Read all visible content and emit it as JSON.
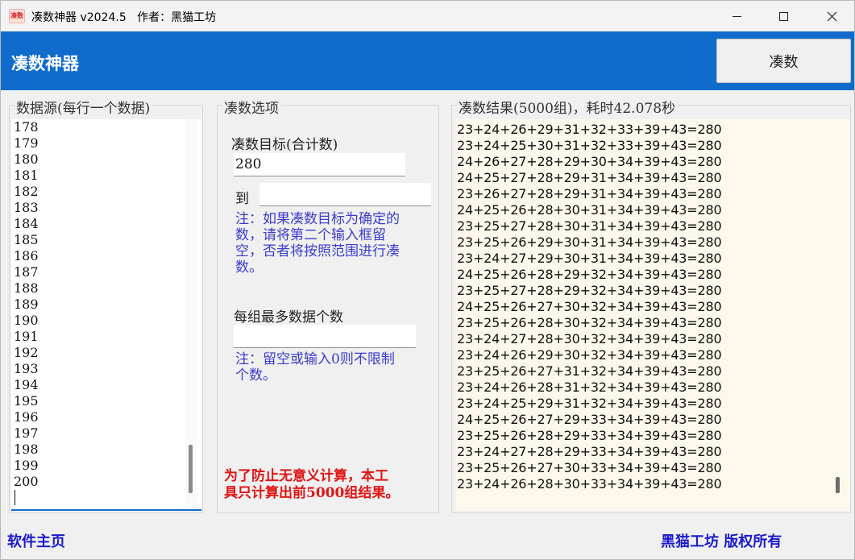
{
  "window": {
    "icon_text": "凑数",
    "title": "凑数神器 v2024.5   作者：黑猫工坊"
  },
  "header": {
    "title": "凑数神器",
    "run_button": "凑数"
  },
  "source": {
    "group_title": "数据源(每行一个数据)",
    "lines": [
      "178",
      "179",
      "180",
      "181",
      "182",
      "183",
      "184",
      "185",
      "186",
      "187",
      "188",
      "189",
      "190",
      "191",
      "192",
      "193",
      "194",
      "195",
      "196",
      "197",
      "198",
      "199",
      "200"
    ]
  },
  "options": {
    "group_title": "凑数选项",
    "target_label": "凑数目标(合计数)",
    "target_value": "280",
    "to_label": "到",
    "to_value": "",
    "note1_lines": [
      "注：如果凑数目标为确定的",
      "数，请将第二个输入框留",
      "空，否者将按照范围进行凑",
      "数。"
    ],
    "max_label": "每组最多数据个数",
    "max_value": "",
    "note2_lines": [
      "注：留空或输入0则不限制",
      "个数。"
    ],
    "warn_lines": [
      "为了防止无意义计算，本工",
      "具只计算出前5000组结果。"
    ]
  },
  "result": {
    "group_title": "凑数结果(5000组)，耗时42.078秒",
    "lines": [
      "23+24+26+29+31+32+33+39+43=280",
      "23+24+25+30+31+32+33+39+43=280",
      "24+26+27+28+29+30+34+39+43=280",
      "24+25+27+28+29+31+34+39+43=280",
      "23+26+27+28+29+31+34+39+43=280",
      "24+25+26+28+30+31+34+39+43=280",
      "23+25+27+28+30+31+34+39+43=280",
      "23+25+26+29+30+31+34+39+43=280",
      "23+24+27+29+30+31+34+39+43=280",
      "24+25+26+28+29+32+34+39+43=280",
      "23+25+27+28+29+32+34+39+43=280",
      "24+25+26+27+30+32+34+39+43=280",
      "23+25+26+28+30+32+34+39+43=280",
      "23+24+27+28+30+32+34+39+43=280",
      "23+24+26+29+30+32+34+39+43=280",
      "23+25+26+27+31+32+34+39+43=280",
      "23+24+26+28+31+32+34+39+43=280",
      "23+24+25+29+31+32+34+39+43=280",
      "24+25+26+27+29+33+34+39+43=280",
      "23+25+26+28+29+33+34+39+43=280",
      "23+24+27+28+29+33+34+39+43=280",
      "23+25+26+27+30+33+34+39+43=280",
      "23+24+26+28+30+33+34+39+43=280"
    ]
  },
  "footer": {
    "home_link": "软件主页",
    "copyright": "黑猫工坊  版权所有"
  },
  "colors": {
    "header_bg": "#0f6ccd",
    "note_text": "#3c3ccf",
    "warn_text": "#e01414",
    "link_text": "#1a1acc",
    "result_bg": "#fdf8ec"
  }
}
